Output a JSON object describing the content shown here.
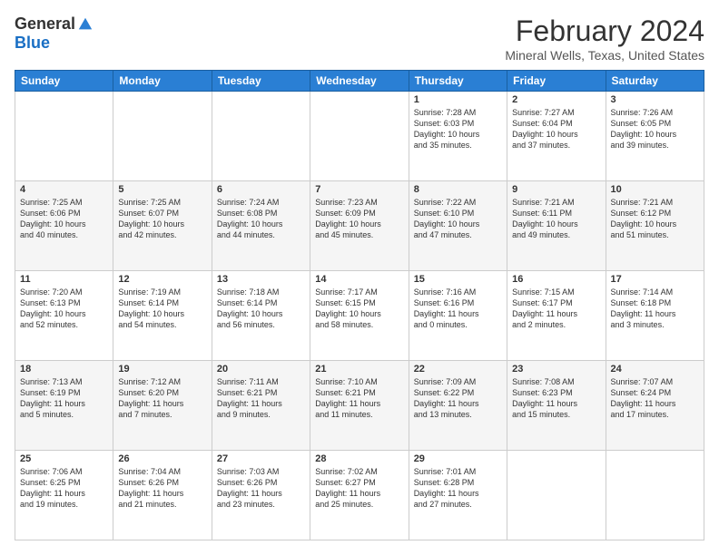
{
  "logo": {
    "general": "General",
    "blue": "Blue"
  },
  "title": "February 2024",
  "subtitle": "Mineral Wells, Texas, United States",
  "days_header": [
    "Sunday",
    "Monday",
    "Tuesday",
    "Wednesday",
    "Thursday",
    "Friday",
    "Saturday"
  ],
  "weeks": [
    [
      {
        "day": "",
        "info": ""
      },
      {
        "day": "",
        "info": ""
      },
      {
        "day": "",
        "info": ""
      },
      {
        "day": "",
        "info": ""
      },
      {
        "day": "1",
        "info": "Sunrise: 7:28 AM\nSunset: 6:03 PM\nDaylight: 10 hours\nand 35 minutes."
      },
      {
        "day": "2",
        "info": "Sunrise: 7:27 AM\nSunset: 6:04 PM\nDaylight: 10 hours\nand 37 minutes."
      },
      {
        "day": "3",
        "info": "Sunrise: 7:26 AM\nSunset: 6:05 PM\nDaylight: 10 hours\nand 39 minutes."
      }
    ],
    [
      {
        "day": "4",
        "info": "Sunrise: 7:25 AM\nSunset: 6:06 PM\nDaylight: 10 hours\nand 40 minutes."
      },
      {
        "day": "5",
        "info": "Sunrise: 7:25 AM\nSunset: 6:07 PM\nDaylight: 10 hours\nand 42 minutes."
      },
      {
        "day": "6",
        "info": "Sunrise: 7:24 AM\nSunset: 6:08 PM\nDaylight: 10 hours\nand 44 minutes."
      },
      {
        "day": "7",
        "info": "Sunrise: 7:23 AM\nSunset: 6:09 PM\nDaylight: 10 hours\nand 45 minutes."
      },
      {
        "day": "8",
        "info": "Sunrise: 7:22 AM\nSunset: 6:10 PM\nDaylight: 10 hours\nand 47 minutes."
      },
      {
        "day": "9",
        "info": "Sunrise: 7:21 AM\nSunset: 6:11 PM\nDaylight: 10 hours\nand 49 minutes."
      },
      {
        "day": "10",
        "info": "Sunrise: 7:21 AM\nSunset: 6:12 PM\nDaylight: 10 hours\nand 51 minutes."
      }
    ],
    [
      {
        "day": "11",
        "info": "Sunrise: 7:20 AM\nSunset: 6:13 PM\nDaylight: 10 hours\nand 52 minutes."
      },
      {
        "day": "12",
        "info": "Sunrise: 7:19 AM\nSunset: 6:14 PM\nDaylight: 10 hours\nand 54 minutes."
      },
      {
        "day": "13",
        "info": "Sunrise: 7:18 AM\nSunset: 6:14 PM\nDaylight: 10 hours\nand 56 minutes."
      },
      {
        "day": "14",
        "info": "Sunrise: 7:17 AM\nSunset: 6:15 PM\nDaylight: 10 hours\nand 58 minutes."
      },
      {
        "day": "15",
        "info": "Sunrise: 7:16 AM\nSunset: 6:16 PM\nDaylight: 11 hours\nand 0 minutes."
      },
      {
        "day": "16",
        "info": "Sunrise: 7:15 AM\nSunset: 6:17 PM\nDaylight: 11 hours\nand 2 minutes."
      },
      {
        "day": "17",
        "info": "Sunrise: 7:14 AM\nSunset: 6:18 PM\nDaylight: 11 hours\nand 3 minutes."
      }
    ],
    [
      {
        "day": "18",
        "info": "Sunrise: 7:13 AM\nSunset: 6:19 PM\nDaylight: 11 hours\nand 5 minutes."
      },
      {
        "day": "19",
        "info": "Sunrise: 7:12 AM\nSunset: 6:20 PM\nDaylight: 11 hours\nand 7 minutes."
      },
      {
        "day": "20",
        "info": "Sunrise: 7:11 AM\nSunset: 6:21 PM\nDaylight: 11 hours\nand 9 minutes."
      },
      {
        "day": "21",
        "info": "Sunrise: 7:10 AM\nSunset: 6:21 PM\nDaylight: 11 hours\nand 11 minutes."
      },
      {
        "day": "22",
        "info": "Sunrise: 7:09 AM\nSunset: 6:22 PM\nDaylight: 11 hours\nand 13 minutes."
      },
      {
        "day": "23",
        "info": "Sunrise: 7:08 AM\nSunset: 6:23 PM\nDaylight: 11 hours\nand 15 minutes."
      },
      {
        "day": "24",
        "info": "Sunrise: 7:07 AM\nSunset: 6:24 PM\nDaylight: 11 hours\nand 17 minutes."
      }
    ],
    [
      {
        "day": "25",
        "info": "Sunrise: 7:06 AM\nSunset: 6:25 PM\nDaylight: 11 hours\nand 19 minutes."
      },
      {
        "day": "26",
        "info": "Sunrise: 7:04 AM\nSunset: 6:26 PM\nDaylight: 11 hours\nand 21 minutes."
      },
      {
        "day": "27",
        "info": "Sunrise: 7:03 AM\nSunset: 6:26 PM\nDaylight: 11 hours\nand 23 minutes."
      },
      {
        "day": "28",
        "info": "Sunrise: 7:02 AM\nSunset: 6:27 PM\nDaylight: 11 hours\nand 25 minutes."
      },
      {
        "day": "29",
        "info": "Sunrise: 7:01 AM\nSunset: 6:28 PM\nDaylight: 11 hours\nand 27 minutes."
      },
      {
        "day": "",
        "info": ""
      },
      {
        "day": "",
        "info": ""
      }
    ]
  ]
}
